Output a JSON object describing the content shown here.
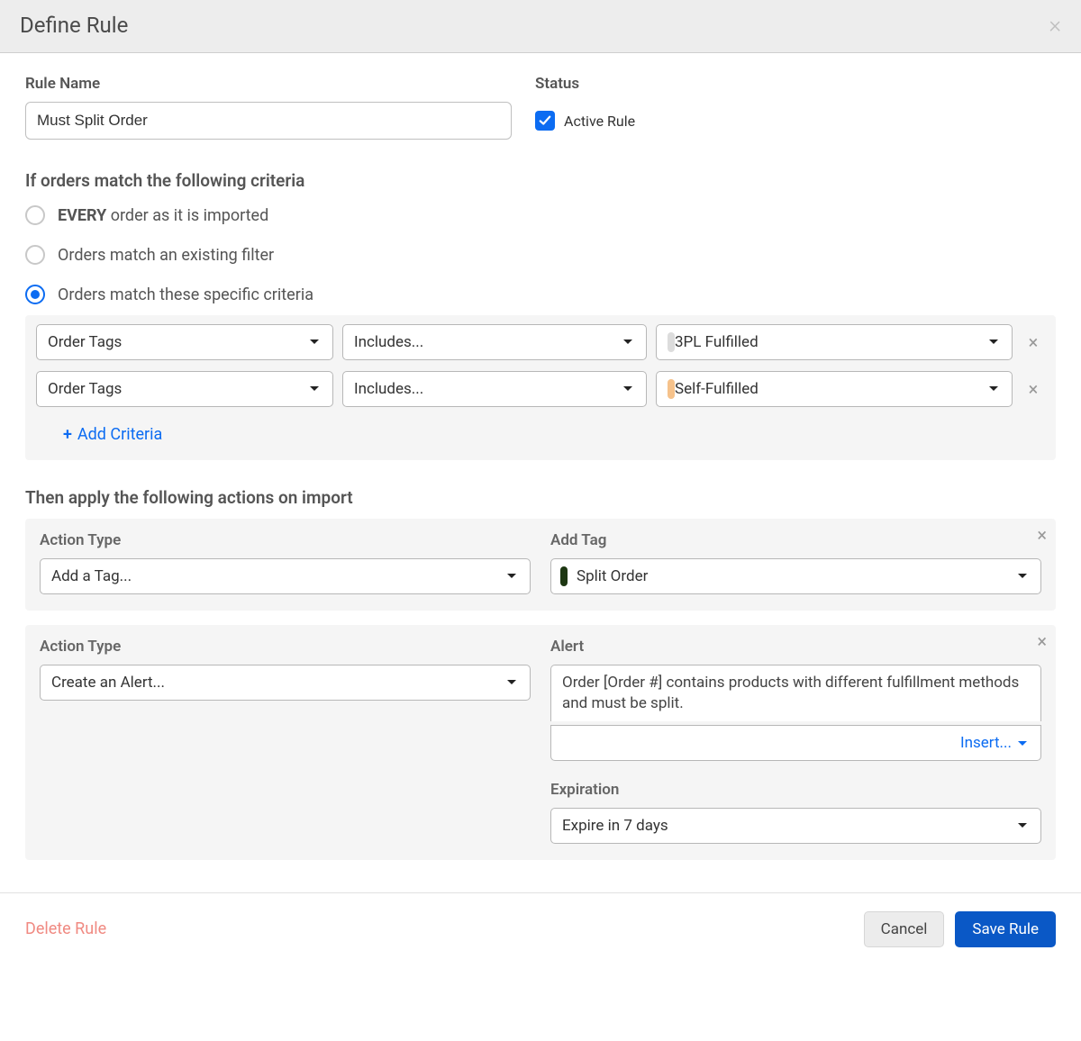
{
  "header": {
    "title": "Define Rule"
  },
  "ruleName": {
    "label": "Rule Name",
    "value": "Must Split Order"
  },
  "status": {
    "label": "Status",
    "checkbox_label": "Active Rule"
  },
  "criteria": {
    "heading": "If orders match the following criteria",
    "radios": {
      "every_bold": "EVERY",
      "every_rest": " order as it is imported",
      "filter": "Orders match an existing filter",
      "specific": "Orders match these specific criteria"
    },
    "rows": [
      {
        "field": "Order Tags",
        "operator": "Includes...",
        "value": "3PL Fulfilled",
        "chip": "light"
      },
      {
        "field": "Order Tags",
        "operator": "Includes...",
        "value": "Self-Fulfilled",
        "chip": "orange"
      }
    ],
    "add_label": "Add Criteria"
  },
  "actions": {
    "heading": "Then apply the following actions on import",
    "type_label": "Action Type",
    "blocks": [
      {
        "type": "Add a Tag...",
        "right_label": "Add Tag",
        "tag_value": "Split Order"
      },
      {
        "type": "Create an Alert...",
        "alert_label": "Alert",
        "alert_text": "Order [Order #] contains products with different fulfillment methods and must be split.",
        "insert_label": "Insert...",
        "expiration_label": "Expiration",
        "expiration_value": "Expire in 7 days"
      }
    ]
  },
  "footer": {
    "delete": "Delete Rule",
    "cancel": "Cancel",
    "save": "Save Rule"
  }
}
